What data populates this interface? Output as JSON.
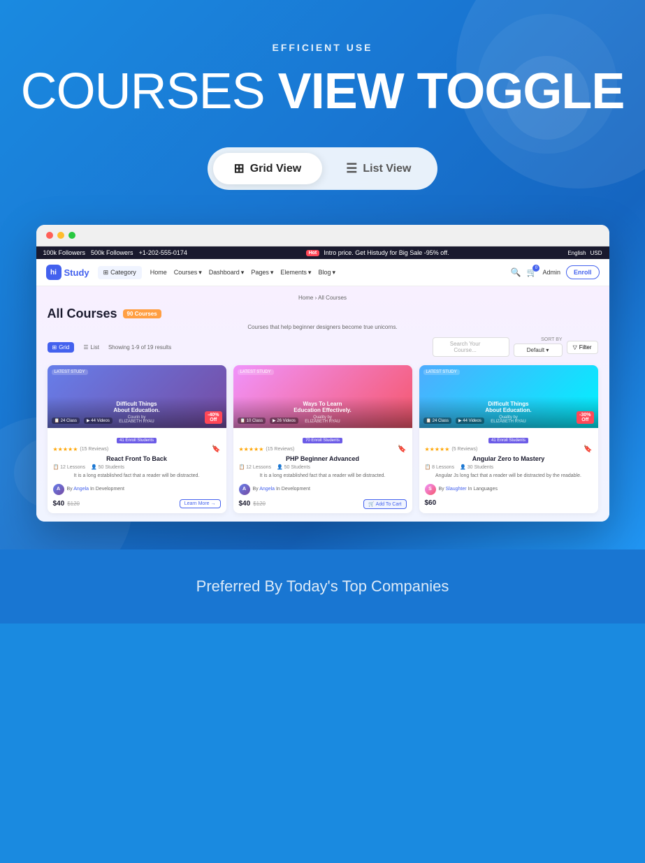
{
  "hero": {
    "subtitle": "EFFICIENT USE",
    "title_part1": "COURSES ",
    "title_part2": "VIEW TOGGLE"
  },
  "toggle": {
    "grid_label": "Grid View",
    "list_label": "List View"
  },
  "browser": {
    "announce_bar": {
      "followers_100k": "100k Followers",
      "followers_500k": "500k Followers",
      "phone": "+1-202-555-0174",
      "hot_label": "Hot",
      "promo_text": "Intro price. Get Histudy for Big Sale -95% off.",
      "language": "English",
      "currency": "USD"
    },
    "navbar": {
      "logo": "hiStudy",
      "logo_hi": "hi",
      "category": "Category",
      "home": "Home",
      "courses": "Courses",
      "dashboard": "Dashboard",
      "pages": "Pages",
      "elements": "Elements",
      "blog": "Blog",
      "admin": "Admin",
      "enroll": "Enroll",
      "cart_count": "0"
    },
    "page": {
      "breadcrumb_home": "Home",
      "breadcrumb_sep": "›",
      "breadcrumb_current": "All Courses",
      "title": "All Courses",
      "count_badge": "90 Courses",
      "description": "Courses that help beginner designers become true unicorns.",
      "view_grid": "Grid",
      "view_list": "List",
      "results": "Showing 1-9 of 19 results",
      "search_placeholder": "Search Your Course...",
      "sort_label": "SORT BY",
      "sort_default": "Default",
      "filter_btn": "Filter"
    },
    "courses": [
      {
        "category": "LATEST STUDY",
        "title": "Difficult Things About Education.",
        "instructor": "ELIZABETH RYAU",
        "stat1": "24 Class",
        "stat2": "44 Videos",
        "enroll_stat": "41 Enroll Students",
        "discount": "-40% Off",
        "rating": "★★★★★",
        "reviews": "(15 Reviews)",
        "name": "React Front To Back",
        "lessons": "12 Lessons",
        "students": "50 Students",
        "desc": "It is a long established fact that a reader will be distracted.",
        "author_name": "Angela",
        "author_category": "Development",
        "price": "$40",
        "old_price": "$120",
        "action": "Learn More →",
        "gradient": "1"
      },
      {
        "category": "LATEST STUDY",
        "title": "Ways To Learn Education Effectively.",
        "instructor": "ELIZABETH RYAU",
        "stat1": "10 Class",
        "stat2": "26 Videos",
        "enroll_stat": "70 Enroll Students",
        "discount": "",
        "rating": "★★★★★",
        "reviews": "(15 Reviews)",
        "name": "PHP Beginner Advanced",
        "lessons": "12 Lessons",
        "students": "50 Students",
        "desc": "It is a long established fact that a reader will be distracted.",
        "author_name": "Angela",
        "author_category": "Development",
        "price": "$40",
        "old_price": "$120",
        "action": "Add To Cart",
        "gradient": "2"
      },
      {
        "category": "LATEST STUDY",
        "title": "Difficult Things About Education.",
        "instructor": "ELIZABETH RYAU",
        "stat1": "24 Class",
        "stat2": "44 Videos",
        "enroll_stat": "41 Enroll Students",
        "discount": "-30% Off",
        "rating": "★★★★★",
        "reviews": "(5 Reviews)",
        "name": "Angular Zero to Mastery",
        "lessons": "8 Lessons",
        "students": "30 Students",
        "desc": "Angular Js long fact that a reader will be distracted by the readable.",
        "author_name": "Slaughter",
        "author_category": "Languages",
        "price": "$60",
        "old_price": "",
        "action": "",
        "gradient": "3"
      }
    ]
  },
  "bottom": {
    "text": "Preferred By Today's Top Companies"
  }
}
